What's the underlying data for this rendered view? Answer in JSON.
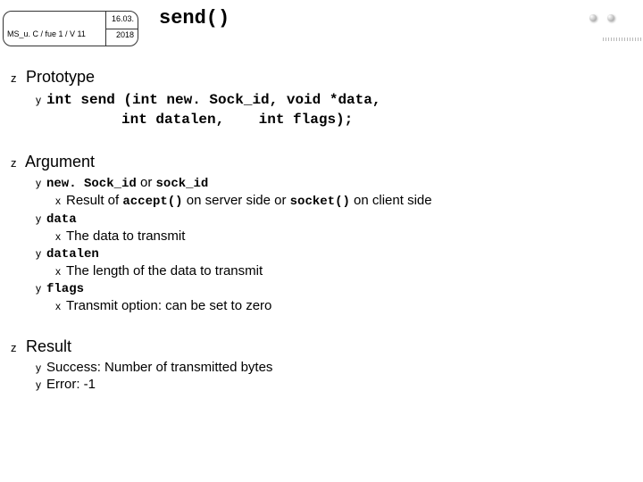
{
  "header": {
    "left": "MS_u. C / fue 1 / V 11",
    "r1": "16.03.",
    "r2": "2018"
  },
  "title": "send()",
  "sections": {
    "prototype": {
      "heading": "Prototype",
      "line1": "int send (int new. Sock_id, void *data,",
      "line2": "          int datalen,    int flags);"
    },
    "argument": {
      "heading": "Argument",
      "items": [
        {
          "label_code1": "new. Sock_id",
          "joiner": " or ",
          "label_code2": "sock_id",
          "subs": [
            {
              "pre": "Result of ",
              "code1": "accept()",
              "mid": " on server side or ",
              "code2": "socket()",
              "post": " on client side"
            }
          ]
        },
        {
          "label_code1": "data",
          "subs": [
            {
              "pre": "The data to transmit"
            }
          ]
        },
        {
          "label_code1": "datalen",
          "subs": [
            {
              "pre": "The length of the data to transmit"
            }
          ]
        },
        {
          "label_code1": "flags",
          "subs": [
            {
              "pre": "Transmit option: can be set to zero"
            }
          ]
        }
      ]
    },
    "result": {
      "heading": "Result",
      "items": [
        "Success: Number of transmitted bytes",
        "Error: -1"
      ]
    }
  }
}
